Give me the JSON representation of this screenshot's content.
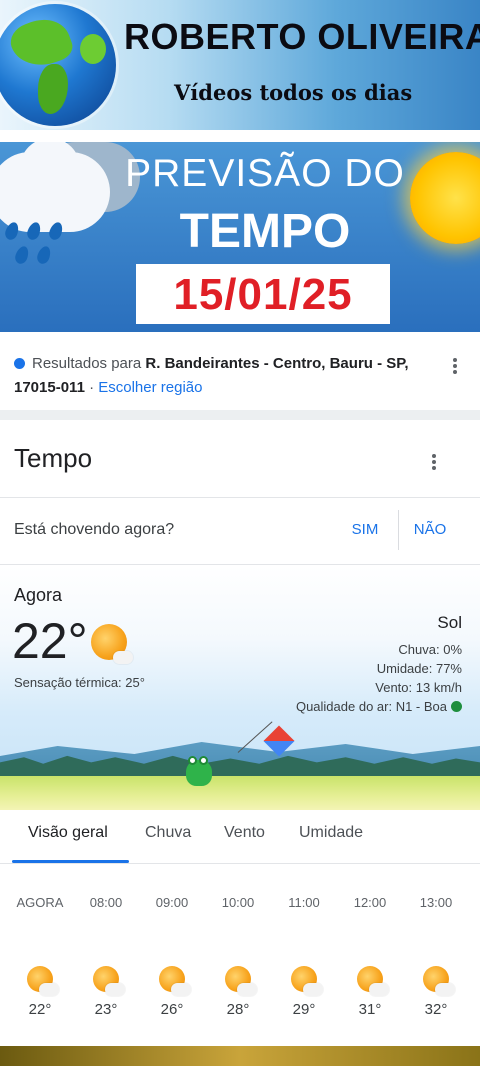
{
  "banner": {
    "title": "ROBERTO OLIVEIRA",
    "subtitle": "Vídeos todos os dias"
  },
  "hero": {
    "line1": "PREVISÃO DO",
    "line2": "TEMPO",
    "date": "15/01/25"
  },
  "results": {
    "prefix": "Resultados para",
    "location": "R. Bandeirantes - Centro, Bauru - SP, 17015-011",
    "separator": "·",
    "change_region": "Escolher região"
  },
  "weather": {
    "title": "Tempo",
    "question": "Está chovendo agora?",
    "yes": "SIM",
    "no": "NÃO",
    "now_label": "Agora",
    "temperature": "22°",
    "feels_like": "Sensação térmica: 25°",
    "condition": "Sol",
    "rain": "Chuva: 0%",
    "humidity": "Umidade: 77%",
    "wind": "Vento: 13 km/h",
    "air_quality": "Qualidade do ar: N1 - Boa",
    "colors": {
      "accent": "#1a73e8",
      "air_quality_good": "#1e8e3e"
    }
  },
  "tabs": [
    "Visão geral",
    "Chuva",
    "Vento",
    "Umidade"
  ],
  "hourly": [
    {
      "time": "AGORA",
      "temp": "22°",
      "icon": "partly-sunny-icon"
    },
    {
      "time": "08:00",
      "temp": "23°",
      "icon": "sunny-icon"
    },
    {
      "time": "09:00",
      "temp": "26°",
      "icon": "sunny-icon"
    },
    {
      "time": "10:00",
      "temp": "28°",
      "icon": "sunny-icon"
    },
    {
      "time": "11:00",
      "temp": "29°",
      "icon": "sunny-icon"
    },
    {
      "time": "12:00",
      "temp": "31°",
      "icon": "sunny-icon"
    },
    {
      "time": "13:00",
      "temp": "32°",
      "icon": "partly-sunny-icon"
    }
  ]
}
